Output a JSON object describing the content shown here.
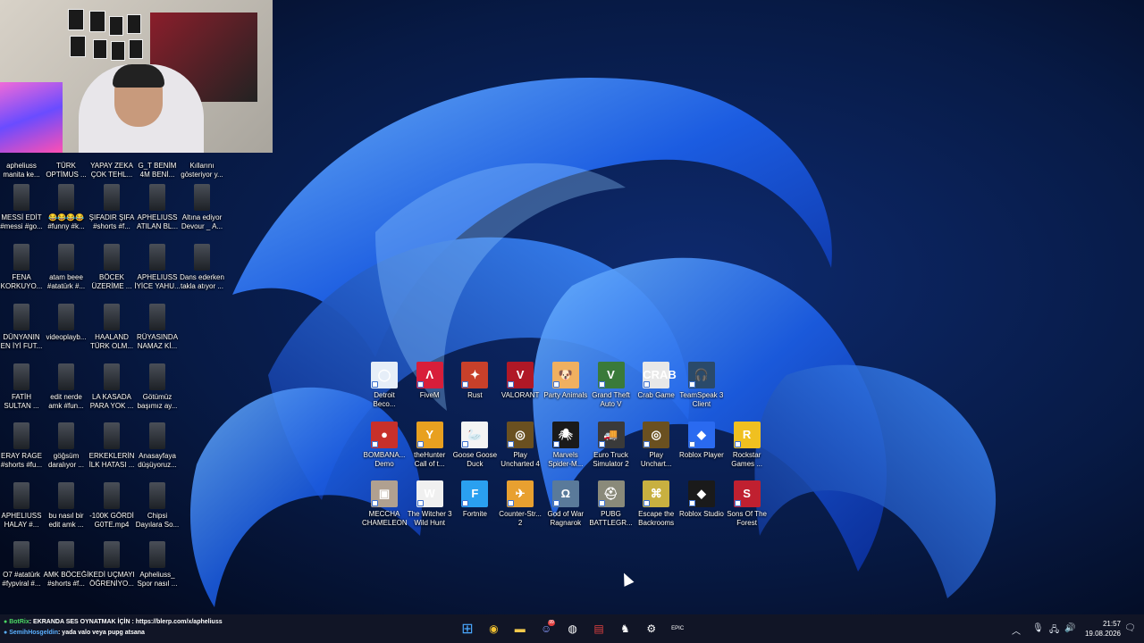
{
  "desktop_videos": [
    {
      "label": "apheliuss manita ke..."
    },
    {
      "label": "TÜRK OPTİMUS ..."
    },
    {
      "label": "YAPAY ZEKA ÇOK TEHL..."
    },
    {
      "label": "G_T BENİM 4M BENİ..."
    },
    {
      "label": "Kıllarını gösteriyor y..."
    },
    {
      "label": "MESSİ EDİT #messi #go..."
    },
    {
      "label": "😂😂😂😂 #funny #k..."
    },
    {
      "label": "ŞIFADIR ŞIFA #shorts #f..."
    },
    {
      "label": "APHELIUSS ATILAN BL..."
    },
    {
      "label": "Altına ediyor Devour _ A..."
    },
    {
      "label": "FENA KORKUYO..."
    },
    {
      "label": "atam beee #atatürk #..."
    },
    {
      "label": "BÖCEK ÜZERİME ..."
    },
    {
      "label": "APHELIUSS İYİCE YAHU..."
    },
    {
      "label": "Dans ederken takla atıyor ..."
    },
    {
      "label": "DÜNYANIN EN İYİ FUT..."
    },
    {
      "label": "videoplayb..."
    },
    {
      "label": "HAALAND TÜRK OLM..."
    },
    {
      "label": "RÜYASINDA NAMAZ Kİ..."
    },
    {
      "label": "FATİH SULTAN ..."
    },
    {
      "label": "edit nerde amk #fun..."
    },
    {
      "label": "LA KASADA PARA YOK ..."
    },
    {
      "label": "Götümüz başımız ay..."
    },
    {
      "label": "ERAY RAGE #shorts #fu..."
    },
    {
      "label": "göğsüm daralıyor ..."
    },
    {
      "label": "ERKEKLERİN İLK HATASI ..."
    },
    {
      "label": "Anasayfaya düşüyoruz..."
    },
    {
      "label": "APHELIUSS HALAY #..."
    },
    {
      "label": "bu nasıl bir edit amk ..."
    },
    {
      "label": "-100K GÖRDİ G0TE.mp4"
    },
    {
      "label": "Chipsi Dayılara So..."
    },
    {
      "label": "O7 #atatürk #fypviral #..."
    },
    {
      "label": "AMK BÖCEĞİ #shorts #f..."
    },
    {
      "label": "KEDİ UÇMAYI ÖĞRENİYO..."
    },
    {
      "label": "Apheliuss_ Spor nasıl ..."
    }
  ],
  "game_shortcuts": [
    {
      "label": "Detroit Beco...",
      "color": "#e6eef8",
      "glyph": "◯"
    },
    {
      "label": "FiveM",
      "color": "#d81e3a",
      "glyph": "Λ"
    },
    {
      "label": "Rust",
      "color": "#c8402a",
      "glyph": "✦"
    },
    {
      "label": "VALORANT",
      "color": "#b01826",
      "glyph": "V"
    },
    {
      "label": "Party Animals",
      "color": "#f0b060",
      "glyph": "🐶"
    },
    {
      "label": "Grand Theft Auto V",
      "color": "#3a7a3a",
      "glyph": "V"
    },
    {
      "label": "Crab Game",
      "color": "#e8e8e8",
      "glyph": "CRAB"
    },
    {
      "label": "TeamSpeak 3 Client",
      "color": "#2a4a6a",
      "glyph": "🎧"
    },
    {
      "label": "BOMBANA... Demo",
      "color": "#c8302a",
      "glyph": "●"
    },
    {
      "label": "theHunter Call of t...",
      "color": "#e8a020",
      "glyph": "Y"
    },
    {
      "label": "Goose Goose Duck",
      "color": "#f4f4f4",
      "glyph": "🦢"
    },
    {
      "label": "Play Uncharted 4",
      "color": "#6a5020",
      "glyph": "◎"
    },
    {
      "label": "Marvels Spider-M...",
      "color": "#1a1a1a",
      "glyph": "🕷"
    },
    {
      "label": "Euro Truck Simulator 2",
      "color": "#3a3a3a",
      "glyph": "🚚"
    },
    {
      "label": "Play Unchart...",
      "color": "#6a5020",
      "glyph": "◎"
    },
    {
      "label": "Roblox Player",
      "color": "#2a6af0",
      "glyph": "◆"
    },
    {
      "label": "Rockstar Games ...",
      "color": "#f0c020",
      "glyph": "R"
    },
    {
      "label": "MECCHA CHAMELEON",
      "color": "#b0a090",
      "glyph": "▣"
    },
    {
      "label": "The Witcher 3 Wild Hunt",
      "color": "#f0f0f0",
      "glyph": "W"
    },
    {
      "label": "Fortnite",
      "color": "#2aa0f0",
      "glyph": "F"
    },
    {
      "label": "Counter-Str... 2",
      "color": "#e8a030",
      "glyph": "✈"
    },
    {
      "label": "God of War Ragnarok",
      "color": "#5a7a9a",
      "glyph": "Ω"
    },
    {
      "label": "PUBG BATTLEGR...",
      "color": "#8a8a7a",
      "glyph": "⛑"
    },
    {
      "label": "Escape the Backrooms",
      "color": "#c8b040",
      "glyph": "⌘"
    },
    {
      "label": "Roblox Studio",
      "color": "#1a1a1a",
      "glyph": "◆"
    },
    {
      "label": "Sons Of The Forest",
      "color": "#c02030",
      "glyph": "S"
    }
  ],
  "chat": {
    "line1_user": "BotRix",
    "line1_text": ": EKRANDA SES OYNATMAK İÇİN : https://blerp.com/x/apheliuss",
    "line2_user": "SemihHosgeldin",
    "line2_text": ": yada valo veya pupg atsana"
  },
  "taskbar": {
    "apps": [
      {
        "name": "windows-start",
        "glyph": "⊞"
      },
      {
        "name": "chrome",
        "glyph": "◉"
      },
      {
        "name": "file-explorer",
        "glyph": "▬"
      },
      {
        "name": "discord",
        "glyph": "☺"
      },
      {
        "name": "obs",
        "glyph": "◍"
      },
      {
        "name": "news",
        "glyph": "▤"
      },
      {
        "name": "ghost-app",
        "glyph": "♞"
      },
      {
        "name": "steam",
        "glyph": "⚙"
      },
      {
        "name": "epic-games",
        "glyph": "EPIC"
      }
    ],
    "discord_badge": "99"
  },
  "clock": {
    "time": "21:57",
    "date": "19.08.2026"
  }
}
